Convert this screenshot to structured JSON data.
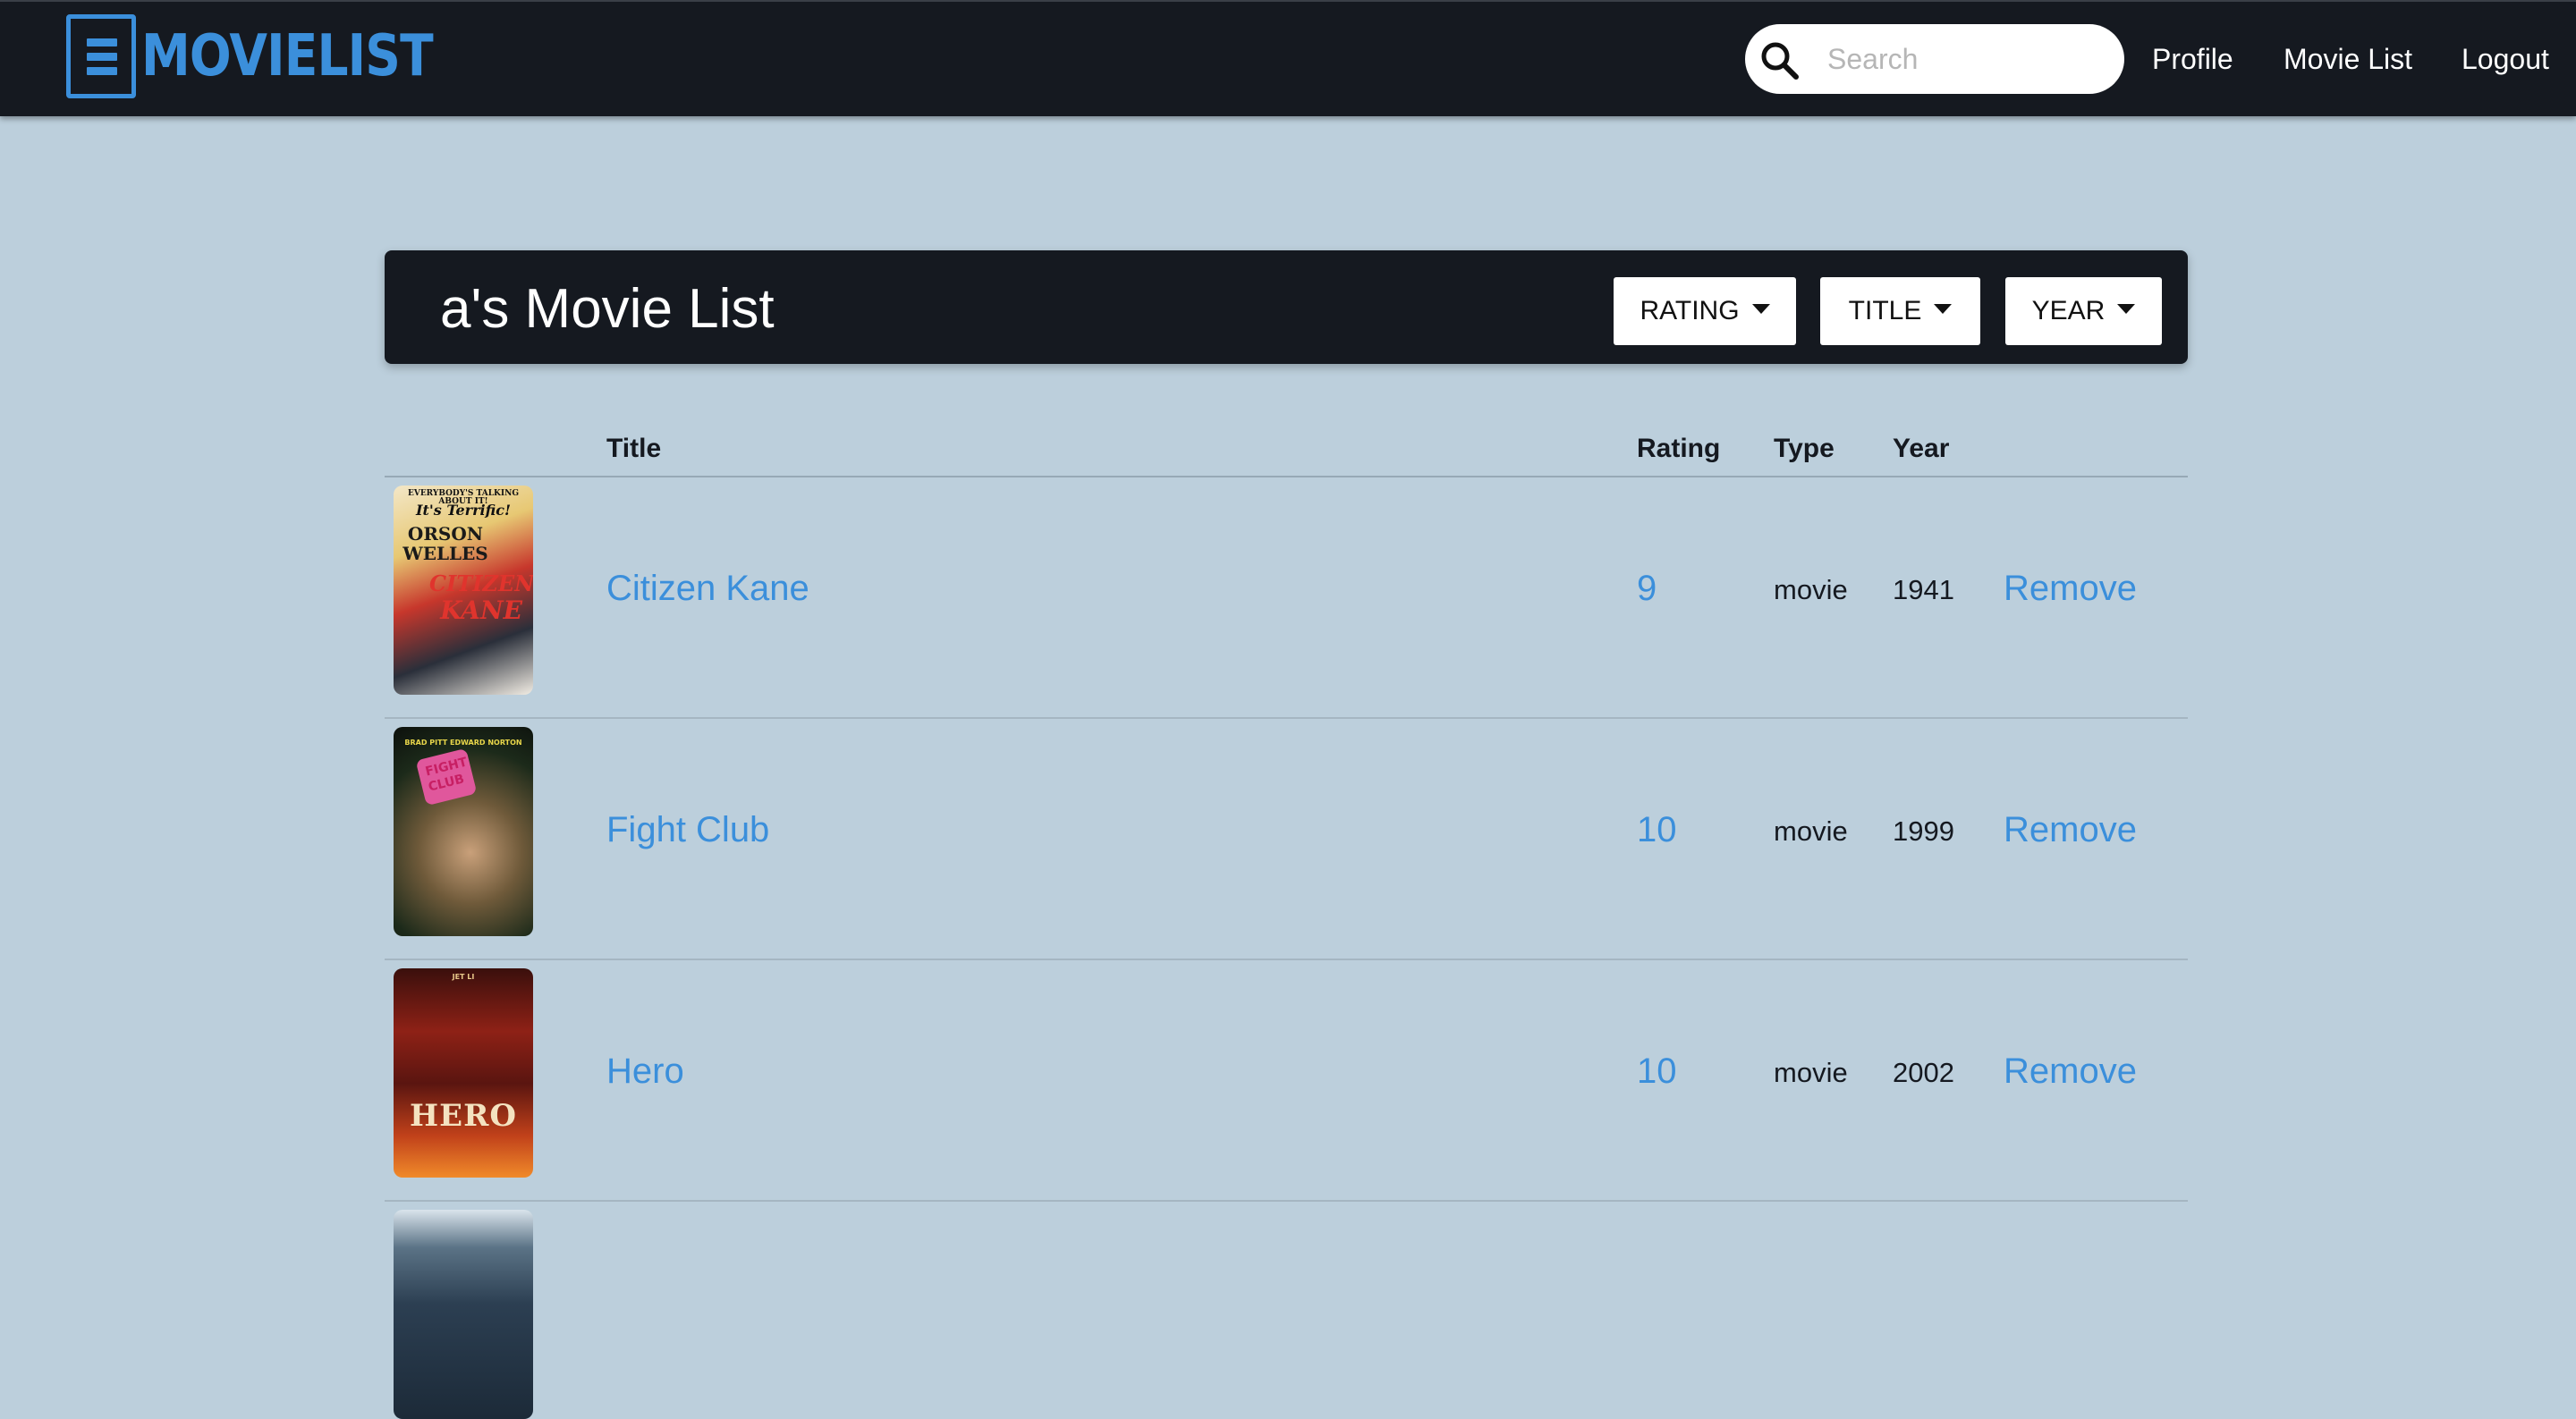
{
  "nav": {
    "brand": "MOVIELIST",
    "search_placeholder": "Search",
    "links": [
      "Profile",
      "Movie List",
      "Logout"
    ]
  },
  "list": {
    "title": "a's Movie List",
    "sort_buttons": [
      "RATING",
      "TITLE",
      "YEAR"
    ]
  },
  "table": {
    "columns": [
      "Title",
      "Rating",
      "Type",
      "Year"
    ],
    "rows": [
      {
        "title": "Citizen Kane",
        "rating": "9",
        "type": "movie",
        "year": "1941",
        "action": "Remove",
        "poster_text": {
          "top": "EVERYBODY'S TALKING ABOUT IT!",
          "tag": "It's Terrific!",
          "name1": "ORSON",
          "name2": "WELLES",
          "title1": "CITIZEN",
          "title2": "KANE"
        }
      },
      {
        "title": "Fight Club",
        "rating": "10",
        "type": "movie",
        "year": "1999",
        "action": "Remove",
        "poster_text": {
          "top": "BRAD PITT   EDWARD NORTON",
          "title1": "FIGHT",
          "title2": "CLUB"
        }
      },
      {
        "title": "Hero",
        "rating": "10",
        "type": "movie",
        "year": "2002",
        "action": "Remove",
        "poster_text": {
          "top": "JET LI",
          "title1": "HERO"
        }
      }
    ]
  },
  "colors": {
    "accent": "#3b8fdb",
    "navbar": "#151920",
    "page_background": "#bccfdc"
  }
}
